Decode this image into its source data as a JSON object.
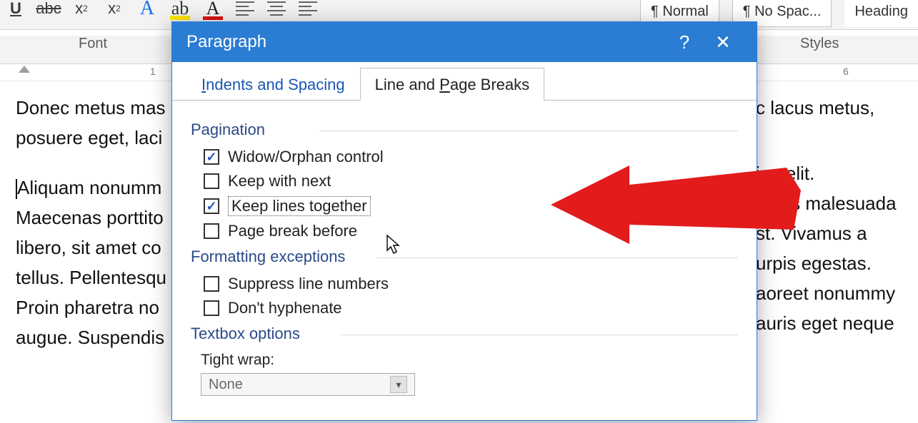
{
  "ribbon": {
    "group_font": "Font",
    "group_styles": "Styles",
    "style_normal": "¶ Normal",
    "style_nospacing": "¶ No Spac...",
    "style_heading": "Heading"
  },
  "ruler": {
    "marks": [
      "1",
      "6"
    ]
  },
  "doc": {
    "p1": "Donec metus mas",
    "p1b": "posuere eget, laci",
    "p2_l1": "Aliquam nonumm",
    "p2_l2": "Maecenas porttito",
    "p2_l3": "libero, sit amet co",
    "p2_l4": "tellus. Pellentesqu",
    "p2_l5": "Proin pharetra no",
    "p2_l6": "augue. Suspendis",
    "r1": "c lacus metus,",
    "r2": "ing elit.",
    "r3": "ectus malesuada",
    "r4": "st. Vivamus a",
    "r5": "urpis egestas.",
    "r6": "aoreet nonummy",
    "r7": "auris eget neque"
  },
  "dialog": {
    "title": "Paragraph",
    "help": "?",
    "close": "✕",
    "tabs": {
      "indents": "Indents and Spacing",
      "linebreaks": "Line and Page Breaks"
    },
    "sections": {
      "pagination": "Pagination",
      "formatting": "Formatting exceptions",
      "textbox": "Textbox options"
    },
    "checks": {
      "widow": "Widow/Orphan control",
      "keepnext": "Keep with next",
      "keeplines": "Keep lines together",
      "pagebreak": "Page break before",
      "suppress": "Suppress line numbers",
      "hyphen": "Don't hyphenate"
    },
    "tightwrap_label": "Tight wrap:",
    "tightwrap_value": "None"
  }
}
